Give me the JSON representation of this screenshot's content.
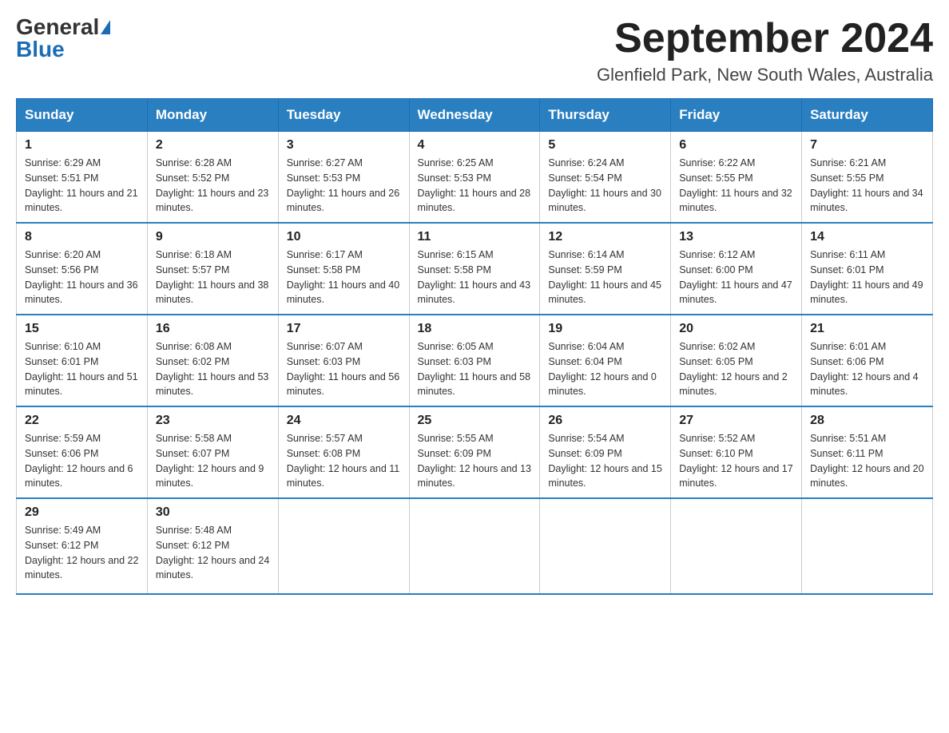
{
  "header": {
    "logo_general": "General",
    "logo_blue": "Blue",
    "month_title": "September 2024",
    "location": "Glenfield Park, New South Wales, Australia"
  },
  "days_of_week": [
    "Sunday",
    "Monday",
    "Tuesday",
    "Wednesday",
    "Thursday",
    "Friday",
    "Saturday"
  ],
  "weeks": [
    [
      {
        "day": "1",
        "sunrise": "6:29 AM",
        "sunset": "5:51 PM",
        "daylight": "11 hours and 21 minutes."
      },
      {
        "day": "2",
        "sunrise": "6:28 AM",
        "sunset": "5:52 PM",
        "daylight": "11 hours and 23 minutes."
      },
      {
        "day": "3",
        "sunrise": "6:27 AM",
        "sunset": "5:53 PM",
        "daylight": "11 hours and 26 minutes."
      },
      {
        "day": "4",
        "sunrise": "6:25 AM",
        "sunset": "5:53 PM",
        "daylight": "11 hours and 28 minutes."
      },
      {
        "day": "5",
        "sunrise": "6:24 AM",
        "sunset": "5:54 PM",
        "daylight": "11 hours and 30 minutes."
      },
      {
        "day": "6",
        "sunrise": "6:22 AM",
        "sunset": "5:55 PM",
        "daylight": "11 hours and 32 minutes."
      },
      {
        "day": "7",
        "sunrise": "6:21 AM",
        "sunset": "5:55 PM",
        "daylight": "11 hours and 34 minutes."
      }
    ],
    [
      {
        "day": "8",
        "sunrise": "6:20 AM",
        "sunset": "5:56 PM",
        "daylight": "11 hours and 36 minutes."
      },
      {
        "day": "9",
        "sunrise": "6:18 AM",
        "sunset": "5:57 PM",
        "daylight": "11 hours and 38 minutes."
      },
      {
        "day": "10",
        "sunrise": "6:17 AM",
        "sunset": "5:58 PM",
        "daylight": "11 hours and 40 minutes."
      },
      {
        "day": "11",
        "sunrise": "6:15 AM",
        "sunset": "5:58 PM",
        "daylight": "11 hours and 43 minutes."
      },
      {
        "day": "12",
        "sunrise": "6:14 AM",
        "sunset": "5:59 PM",
        "daylight": "11 hours and 45 minutes."
      },
      {
        "day": "13",
        "sunrise": "6:12 AM",
        "sunset": "6:00 PM",
        "daylight": "11 hours and 47 minutes."
      },
      {
        "day": "14",
        "sunrise": "6:11 AM",
        "sunset": "6:01 PM",
        "daylight": "11 hours and 49 minutes."
      }
    ],
    [
      {
        "day": "15",
        "sunrise": "6:10 AM",
        "sunset": "6:01 PM",
        "daylight": "11 hours and 51 minutes."
      },
      {
        "day": "16",
        "sunrise": "6:08 AM",
        "sunset": "6:02 PM",
        "daylight": "11 hours and 53 minutes."
      },
      {
        "day": "17",
        "sunrise": "6:07 AM",
        "sunset": "6:03 PM",
        "daylight": "11 hours and 56 minutes."
      },
      {
        "day": "18",
        "sunrise": "6:05 AM",
        "sunset": "6:03 PM",
        "daylight": "11 hours and 58 minutes."
      },
      {
        "day": "19",
        "sunrise": "6:04 AM",
        "sunset": "6:04 PM",
        "daylight": "12 hours and 0 minutes."
      },
      {
        "day": "20",
        "sunrise": "6:02 AM",
        "sunset": "6:05 PM",
        "daylight": "12 hours and 2 minutes."
      },
      {
        "day": "21",
        "sunrise": "6:01 AM",
        "sunset": "6:06 PM",
        "daylight": "12 hours and 4 minutes."
      }
    ],
    [
      {
        "day": "22",
        "sunrise": "5:59 AM",
        "sunset": "6:06 PM",
        "daylight": "12 hours and 6 minutes."
      },
      {
        "day": "23",
        "sunrise": "5:58 AM",
        "sunset": "6:07 PM",
        "daylight": "12 hours and 9 minutes."
      },
      {
        "day": "24",
        "sunrise": "5:57 AM",
        "sunset": "6:08 PM",
        "daylight": "12 hours and 11 minutes."
      },
      {
        "day": "25",
        "sunrise": "5:55 AM",
        "sunset": "6:09 PM",
        "daylight": "12 hours and 13 minutes."
      },
      {
        "day": "26",
        "sunrise": "5:54 AM",
        "sunset": "6:09 PM",
        "daylight": "12 hours and 15 minutes."
      },
      {
        "day": "27",
        "sunrise": "5:52 AM",
        "sunset": "6:10 PM",
        "daylight": "12 hours and 17 minutes."
      },
      {
        "day": "28",
        "sunrise": "5:51 AM",
        "sunset": "6:11 PM",
        "daylight": "12 hours and 20 minutes."
      }
    ],
    [
      {
        "day": "29",
        "sunrise": "5:49 AM",
        "sunset": "6:12 PM",
        "daylight": "12 hours and 22 minutes."
      },
      {
        "day": "30",
        "sunrise": "5:48 AM",
        "sunset": "6:12 PM",
        "daylight": "12 hours and 24 minutes."
      },
      null,
      null,
      null,
      null,
      null
    ]
  ],
  "labels": {
    "sunrise": "Sunrise:",
    "sunset": "Sunset:",
    "daylight": "Daylight:"
  }
}
